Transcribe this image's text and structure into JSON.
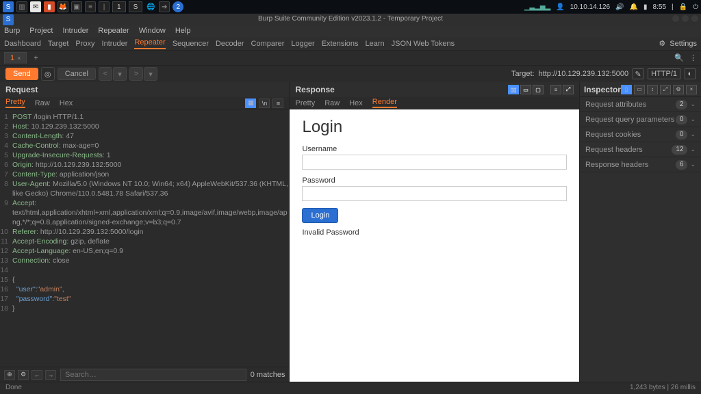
{
  "os_taskbar": {
    "ip": "10.10.14.126",
    "time": "8:55",
    "task_tabs": [
      "1",
      "S"
    ]
  },
  "titlebar": "Burp Suite Community Edition v2023.1.2 - Temporary Project",
  "menubar": [
    "Burp",
    "Project",
    "Intruder",
    "Repeater",
    "Window",
    "Help"
  ],
  "toolbar": {
    "items": [
      "Dashboard",
      "Target",
      "Proxy",
      "Intruder",
      "Repeater",
      "Sequencer",
      "Decoder",
      "Comparer",
      "Logger",
      "Extensions",
      "Learn",
      "JSON Web Tokens"
    ],
    "settings": "Settings"
  },
  "repeater": {
    "tab_label": "1",
    "send": "Send",
    "cancel": "Cancel",
    "target_label": "Target:",
    "target_value": "http://10.129.239.132:5000",
    "protocol": "HTTP/1"
  },
  "request": {
    "title": "Request",
    "tabs": [
      "Pretty",
      "Raw",
      "Hex"
    ],
    "active_tab": "Pretty",
    "lines": [
      {
        "n": "1",
        "kw": "POST",
        "rest": " /login HTTP/1.1"
      },
      {
        "n": "2",
        "kw": "Host",
        "sep": ": ",
        "val": "10.129.239.132:5000"
      },
      {
        "n": "3",
        "kw": "Content-Length",
        "sep": ": ",
        "val": "47"
      },
      {
        "n": "4",
        "kw": "Cache-Control",
        "sep": ": ",
        "val": "max-age=0"
      },
      {
        "n": "5",
        "kw": "Upgrade-Insecure-Requests",
        "sep": ": ",
        "val": "1"
      },
      {
        "n": "6",
        "kw": "Origin",
        "sep": ": ",
        "val": "http://10.129.239.132:5000"
      },
      {
        "n": "7",
        "kw": "Content-Type",
        "sep": ": ",
        "val": "application/json"
      },
      {
        "n": "8",
        "kw": "User-Agent",
        "sep": ": ",
        "val": "Mozilla/5.0 (Windows NT 10.0; Win64; x64) AppleWebKit/537.36 (KHTML,"
      },
      {
        "n": "",
        "kw": "",
        "sep": "",
        "val": "like Gecko) Chrome/110.0.5481.78 Safari/537.36"
      },
      {
        "n": "9",
        "kw": "Accept",
        "sep": ":",
        "val": ""
      },
      {
        "n": "",
        "kw": "",
        "sep": "",
        "val": "text/html,application/xhtml+xml,application/xml;q=0.9,image/avif,image/webp,image/ap"
      },
      {
        "n": "",
        "kw": "",
        "sep": "",
        "val": "ng,*/*;q=0.8,application/signed-exchange;v=b3;q=0.7"
      },
      {
        "n": "10",
        "kw": "Referer",
        "sep": ": ",
        "val": "http://10.129.239.132:5000/login"
      },
      {
        "n": "11",
        "kw": "Accept-Encoding",
        "sep": ": ",
        "val": "gzip, deflate"
      },
      {
        "n": "12",
        "kw": "Accept-Language",
        "sep": ": ",
        "val": "en-US,en;q=0.9"
      },
      {
        "n": "13",
        "kw": "Connection",
        "sep": ": ",
        "val": "close"
      },
      {
        "n": "14",
        "kw": "",
        "sep": "",
        "val": ""
      },
      {
        "n": "15",
        "raw": "{"
      },
      {
        "n": "16",
        "json_k": "\"user\"",
        "json_v": "\"admin\"",
        "comma": ","
      },
      {
        "n": "17",
        "json_k": "\"password\"",
        "json_v": "\"test\""
      },
      {
        "n": "18",
        "raw": "}"
      }
    ],
    "search_placeholder": "Search…",
    "search_matches": "0 matches"
  },
  "response": {
    "title": "Response",
    "tabs": [
      "Pretty",
      "Raw",
      "Hex",
      "Render"
    ],
    "active_tab": "Render",
    "render": {
      "heading": "Login",
      "username_label": "Username",
      "password_label": "Password",
      "login_button": "Login",
      "message": "Invalid Password"
    }
  },
  "inspector": {
    "title": "Inspector",
    "rows": [
      {
        "label": "Request attributes",
        "count": "2"
      },
      {
        "label": "Request query parameters",
        "count": "0"
      },
      {
        "label": "Request cookies",
        "count": "0"
      },
      {
        "label": "Request headers",
        "count": "12"
      },
      {
        "label": "Response headers",
        "count": "6"
      }
    ]
  },
  "statusbar": {
    "left": "Done",
    "right": "1,243 bytes | 26 millis"
  }
}
